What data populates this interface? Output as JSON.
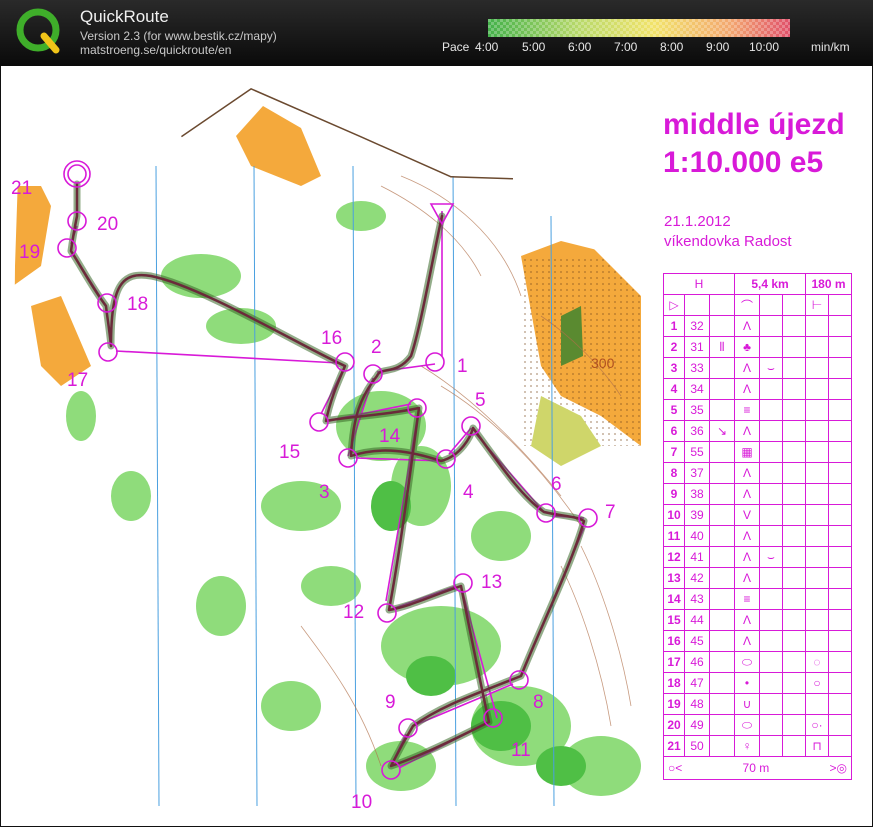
{
  "app": {
    "name": "QuickRoute",
    "version": "Version 2.3  (for www.bestik.cz/mapy)",
    "url": "matstroeng.se/quickroute/en"
  },
  "pace_legend": {
    "label": "Pace",
    "ticks": [
      "4:00",
      "5:00",
      "6:00",
      "7:00",
      "8:00",
      "9:00",
      "10:00"
    ],
    "unit": "min/km"
  },
  "map": {
    "title_line1": "middle újezd",
    "title_line2": "1:10.000 e5",
    "date": "21.1.2012",
    "location": "víkendovka Radost",
    "contour_label": "300",
    "control_labels": [
      "1",
      "2",
      "3",
      "4",
      "5",
      "6",
      "7",
      "8",
      "9",
      "10",
      "11",
      "12",
      "13",
      "14",
      "15",
      "16",
      "17",
      "18",
      "19",
      "20",
      "21"
    ]
  },
  "control_descriptions": {
    "course": "H",
    "length": "5,4 km",
    "climb": "180 m",
    "finish_distance": "70 m",
    "rows": [
      {
        "num": "1",
        "code": "32"
      },
      {
        "num": "2",
        "code": "31"
      },
      {
        "num": "3",
        "code": "33"
      },
      {
        "num": "4",
        "code": "34"
      },
      {
        "num": "5",
        "code": "35"
      },
      {
        "num": "6",
        "code": "36"
      },
      {
        "num": "7",
        "code": "55"
      },
      {
        "num": "8",
        "code": "37"
      },
      {
        "num": "9",
        "code": "38"
      },
      {
        "num": "10",
        "code": "39"
      },
      {
        "num": "11",
        "code": "40"
      },
      {
        "num": "12",
        "code": "41"
      },
      {
        "num": "13",
        "code": "42"
      },
      {
        "num": "14",
        "code": "43"
      },
      {
        "num": "15",
        "code": "44"
      },
      {
        "num": "16",
        "code": "45"
      },
      {
        "num": "17",
        "code": "46"
      },
      {
        "num": "18",
        "code": "47"
      },
      {
        "num": "19",
        "code": "48"
      },
      {
        "num": "20",
        "code": "49"
      },
      {
        "num": "21",
        "code": "50"
      }
    ]
  },
  "colors": {
    "course_magenta": "#d81ad8",
    "route": "#6b2a3a",
    "forest_green": "#7ed36b",
    "open_orange": "#f4a93c",
    "pace_fast": "#4fb84f",
    "pace_slow": "#e0506a"
  }
}
